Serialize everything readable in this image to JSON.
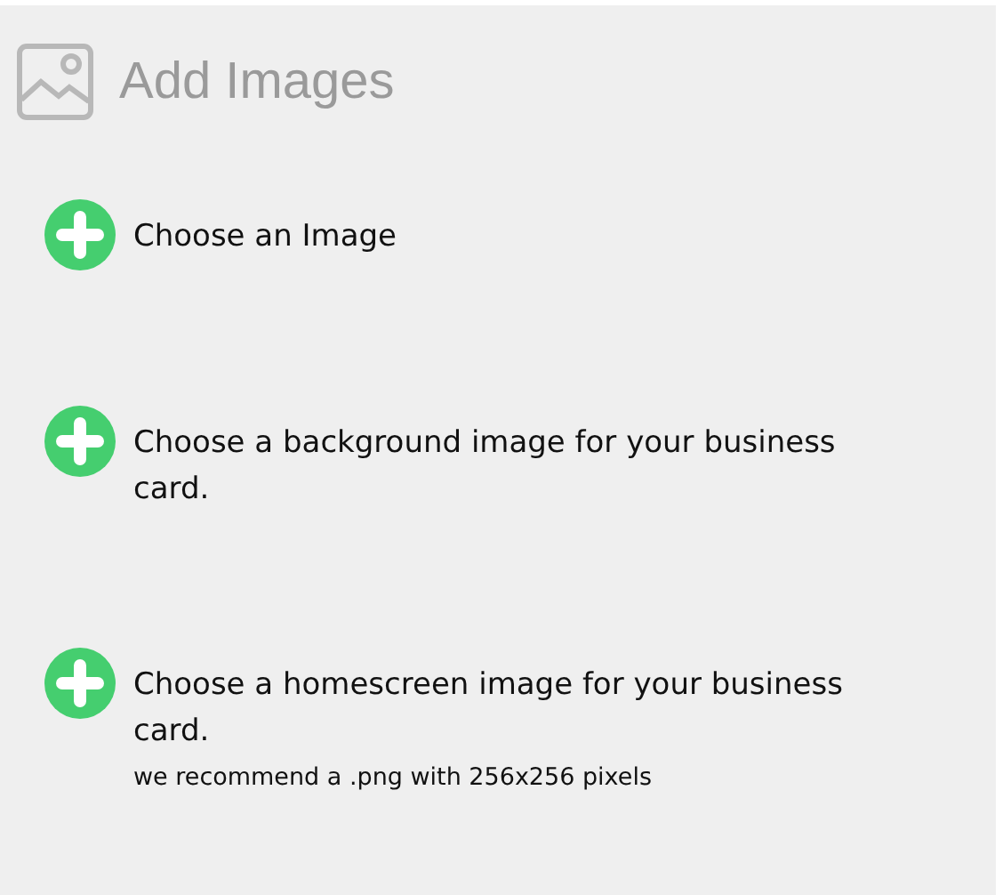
{
  "header": {
    "title": "Add Images"
  },
  "items": [
    {
      "label": "Choose an Image"
    },
    {
      "label": "Choose a background image for your business card."
    },
    {
      "label": "Choose a homescreen image for your business card.",
      "note": "we recommend a .png with 256x256 pixels"
    }
  ]
}
